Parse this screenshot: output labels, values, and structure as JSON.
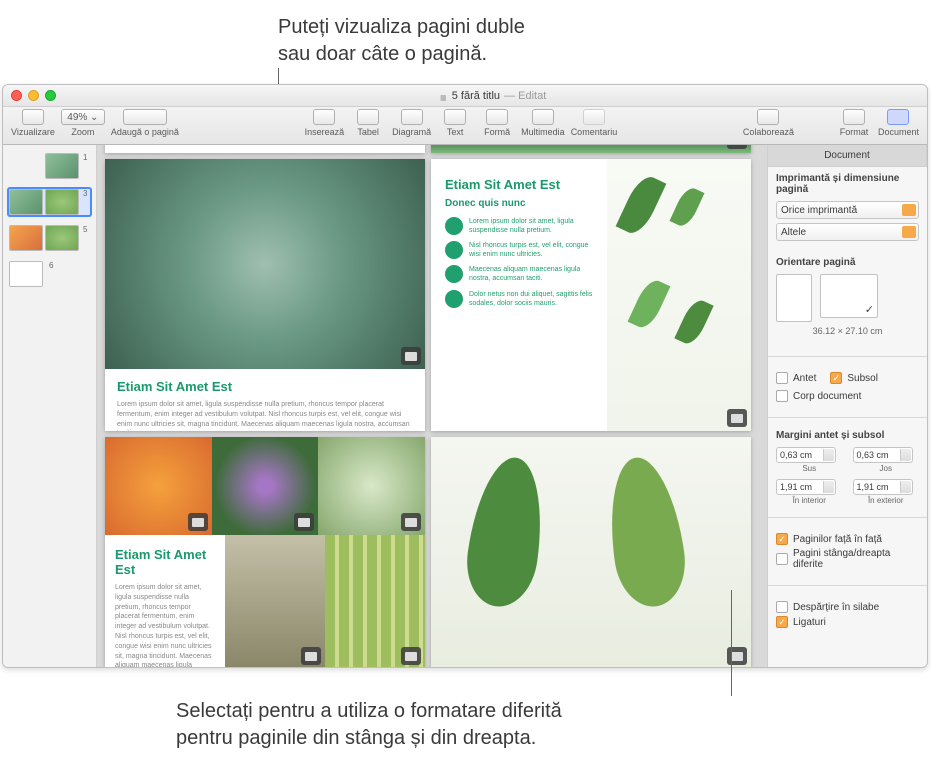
{
  "callouts": {
    "top": "Puteți vizualiza pagini duble\nsau doar câte o pagină.",
    "bottom": "Selectați pentru a utiliza o formatare diferită\npentru paginile din stânga și din dreapta."
  },
  "title": {
    "docname": "5 fără titlu",
    "edited": "— Editat"
  },
  "toolbar": {
    "view": "Vizualizare",
    "zoom_value": "49% ⌄",
    "zoom": "Zoom",
    "addpage": "Adaugă o pagină",
    "insert": "Inserează",
    "table": "Tabel",
    "chart": "Diagramă",
    "text": "Text",
    "shape": "Formă",
    "media": "Multimedia",
    "comment": "Comentariu",
    "collab": "Colaborează",
    "format": "Format",
    "document": "Document"
  },
  "thumbs": {
    "p1": "1",
    "p3": "3",
    "p5": "5",
    "p6": "6"
  },
  "content": {
    "etiam_title": "Etiam Sit Amet Est",
    "etiam_sub": "Donec quis nunc",
    "etiam_body": "Lorem ipsum dolor sit amet, ligula suspendisse nulla pretium, rhoncus tempor placerat fermentum, enim integer ad vestibulum volutpat. Nisl rhoncus turpis est, vel elit, congue wisi enim nunc ultricies sit, magna tincidunt. Maecenas aliquam maecenas ligula nostra, accumsan taciti.",
    "b1": "Lorem ipsum dolor sit amet, ligula suspendisse nulla pretium.",
    "b2": "Nisl rhoncus turpis est, vel elit, congue wisi enim nunc ultricies.",
    "b3": "Maecenas aliquam maecenas ligula nostra, accumsan taciti.",
    "b4": "Dolor netus non dui aliquet, sagittis felis sodales, dolor sociis mauris."
  },
  "inspector": {
    "tab_document": "Document",
    "printer_heading": "Imprimantă și dimensiune pagină",
    "printer_any": "Orice imprimantă",
    "printer_other": "Altele",
    "orient_heading": "Orientare pagină",
    "dims": "36.12 × 27.10 cm",
    "header": "Antet",
    "footer": "Subsol",
    "body": "Corp document",
    "margins_heading": "Margini antet și subsol",
    "m_top_v": "0,63 cm",
    "m_top_l": "Sus",
    "m_bot_v": "0,63 cm",
    "m_bot_l": "Jos",
    "m_in_v": "1,91 cm",
    "m_in_l": "În interior",
    "m_out_v": "1,91 cm",
    "m_out_l": "În exterior",
    "facing": "Paginilor față în față",
    "diff_lr": "Pagini stânga/dreapta diferite",
    "hyphen": "Despărțire în silabe",
    "ligatures": "Ligaturi"
  }
}
